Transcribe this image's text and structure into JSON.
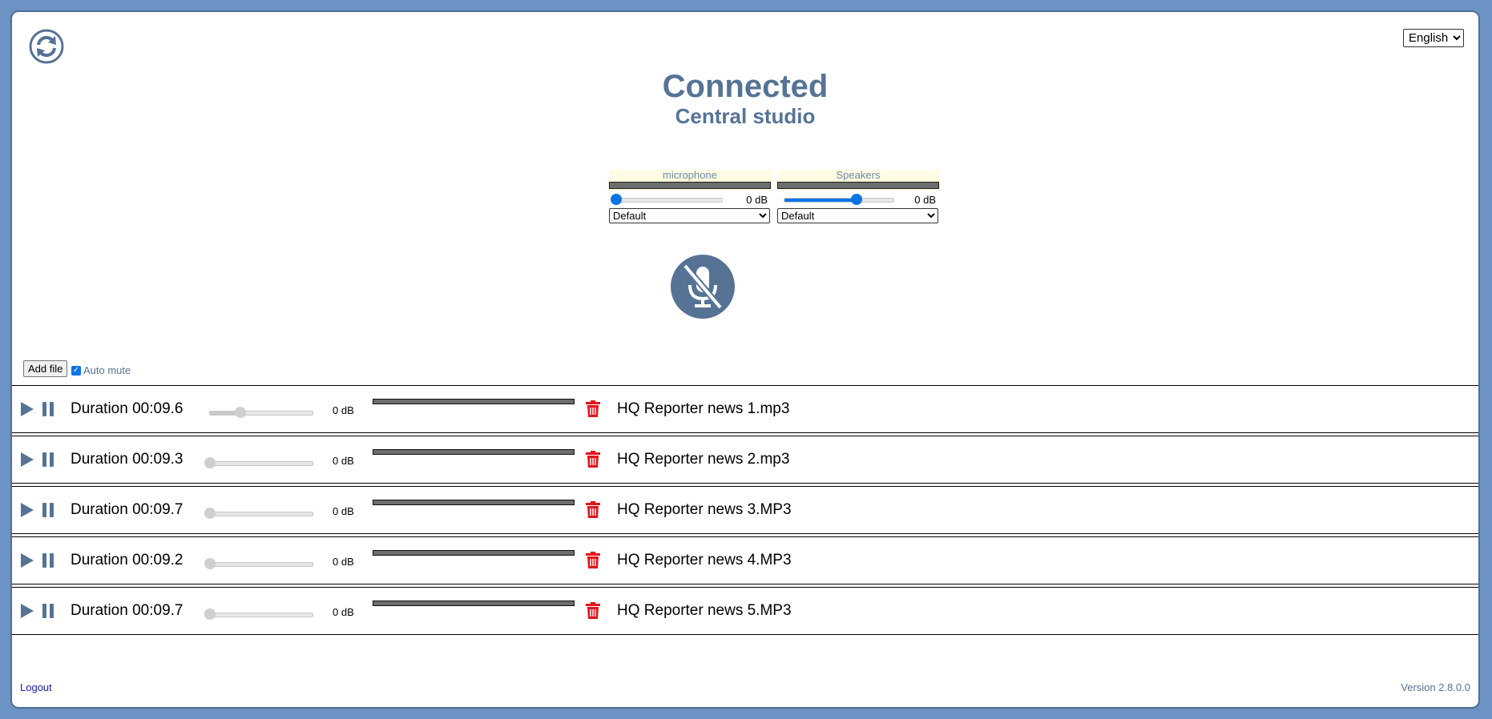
{
  "header": {
    "language_selected": "English",
    "status": "Connected",
    "studio": "Central studio"
  },
  "devices": {
    "input": {
      "label": "microphone",
      "gain": "0 dB",
      "device": "Default",
      "level_fraction": 0.0
    },
    "output": {
      "label": "Speakers",
      "gain": "0 dB",
      "device": "Default",
      "level_fraction": 0.66
    }
  },
  "controls": {
    "add_file_label": "Add file",
    "auto_mute_label": "Auto mute",
    "auto_mute_checked": true
  },
  "files": [
    {
      "duration": "Duration 00:09.6",
      "gain": "0 dB",
      "name": "HQ Reporter news 1.mp3",
      "volume_fraction": 0.3
    },
    {
      "duration": "Duration 00:09.3",
      "gain": "0 dB",
      "name": "HQ Reporter news 2.mp3",
      "volume_fraction": 0.0
    },
    {
      "duration": "Duration 00:09.7",
      "gain": "0 dB",
      "name": "HQ Reporter news 3.MP3",
      "volume_fraction": 0.0
    },
    {
      "duration": "Duration 00:09.2",
      "gain": "0 dB",
      "name": "HQ Reporter news 4.MP3",
      "volume_fraction": 0.0
    },
    {
      "duration": "Duration 00:09.7",
      "gain": "0 dB",
      "name": "HQ Reporter news 5.MP3",
      "volume_fraction": 0.0
    }
  ],
  "footer": {
    "logout": "Logout",
    "version": "Version 2.8.0.0"
  },
  "colors": {
    "brand": "#567396",
    "delete": "#e0151b",
    "slider_active": "#0b74e5",
    "background": "#6b93c3"
  },
  "icons": {
    "refresh": "refresh-icon",
    "mute": "microphone-muted-icon",
    "play": "play-icon",
    "pause": "pause-icon",
    "delete": "trash-icon"
  }
}
